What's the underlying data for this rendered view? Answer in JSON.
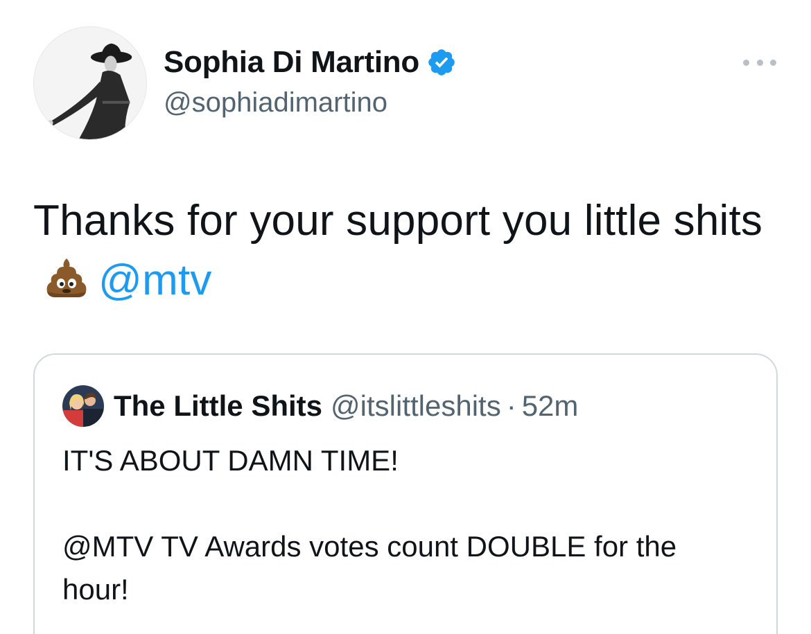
{
  "author": {
    "display_name": "Sophia Di Martino",
    "handle": "@sophiadimartino",
    "verified": true,
    "avatar_icon": "profile-photo-avatar"
  },
  "more_menu": {
    "icon": "ellipsis-icon"
  },
  "tweet": {
    "text_part1": "Thanks for your support you little shits",
    "emoji": "pile-of-poo-emoji",
    "mention": "@mtv"
  },
  "quote": {
    "display_name": "The Little Shits",
    "handle": "@itslittleshits",
    "separator": "·",
    "time": "52m",
    "line1": "IT'S ABOUT DAMN TIME!",
    "line2": "@MTV TV Awards votes count DOUBLE for the hour!"
  },
  "colors": {
    "link": "#1d9bf0",
    "secondary_text": "#536471",
    "border": "#cfd9de",
    "verified_badge": "#1d9bf0"
  }
}
